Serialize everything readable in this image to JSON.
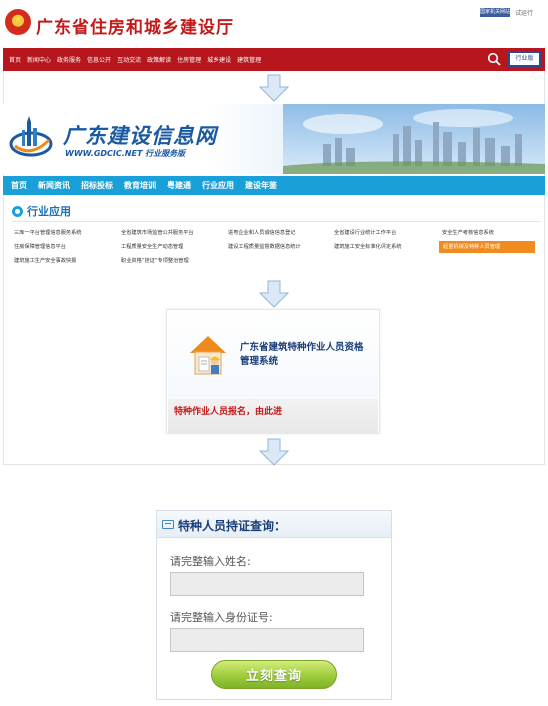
{
  "gov_header": {
    "title": "广东省住房和城乡建设厅",
    "top_badge": "国家机关网站标识",
    "top_link": "试运行"
  },
  "red_nav": {
    "items": [
      "首页",
      "新闻中心",
      "政务服务",
      "信息公开",
      "互动交流",
      "政策解读",
      "住房管理",
      "城乡建设",
      "建筑管理"
    ],
    "button_label": "行业版"
  },
  "gdcic": {
    "title": "广东建设信息网",
    "subtitle": "WWW.GDCIC.NET 行业服务版",
    "nav": [
      "首页",
      "新闻资讯",
      "招标投标",
      "教育培训",
      "粤建通",
      "行业应用",
      "建设年鉴"
    ],
    "section_title": "行业应用",
    "apps": [
      [
        "三库一平台管理信息服务系统",
        "全省建筑市场监管公共服务平台",
        "进粤企业和人员诚信信息登记",
        "全省建设行业统计工作平台",
        "安全生产考核信息系统"
      ],
      [
        "住房保障管理信息平台",
        "工程质量安全生产动态管理",
        "建设工程质量监督数据信息统计",
        "建筑施工安全标准化评定系统",
        "起重机械及特种人员管理"
      ],
      [
        "建筑施工生产安全事故快报",
        "职业资格“挂证”专项整治管理"
      ]
    ]
  },
  "special_card": {
    "title": "广东省建筑特种作业人员资格管理系统",
    "enter_text": "特种作业人员报名，由此进"
  },
  "query": {
    "title": "特种人员持证查询：",
    "name_label": "请完整输入姓名:",
    "name_value": "",
    "id_label": "请完整输入身份证号:",
    "id_value": "",
    "submit_label": "立刻查询"
  },
  "colors": {
    "gov_red": "#b6161c",
    "gdcic_blue": "#1aa0d8",
    "highlight_orange": "#f28b1f",
    "query_green": "#9dcc3c"
  }
}
